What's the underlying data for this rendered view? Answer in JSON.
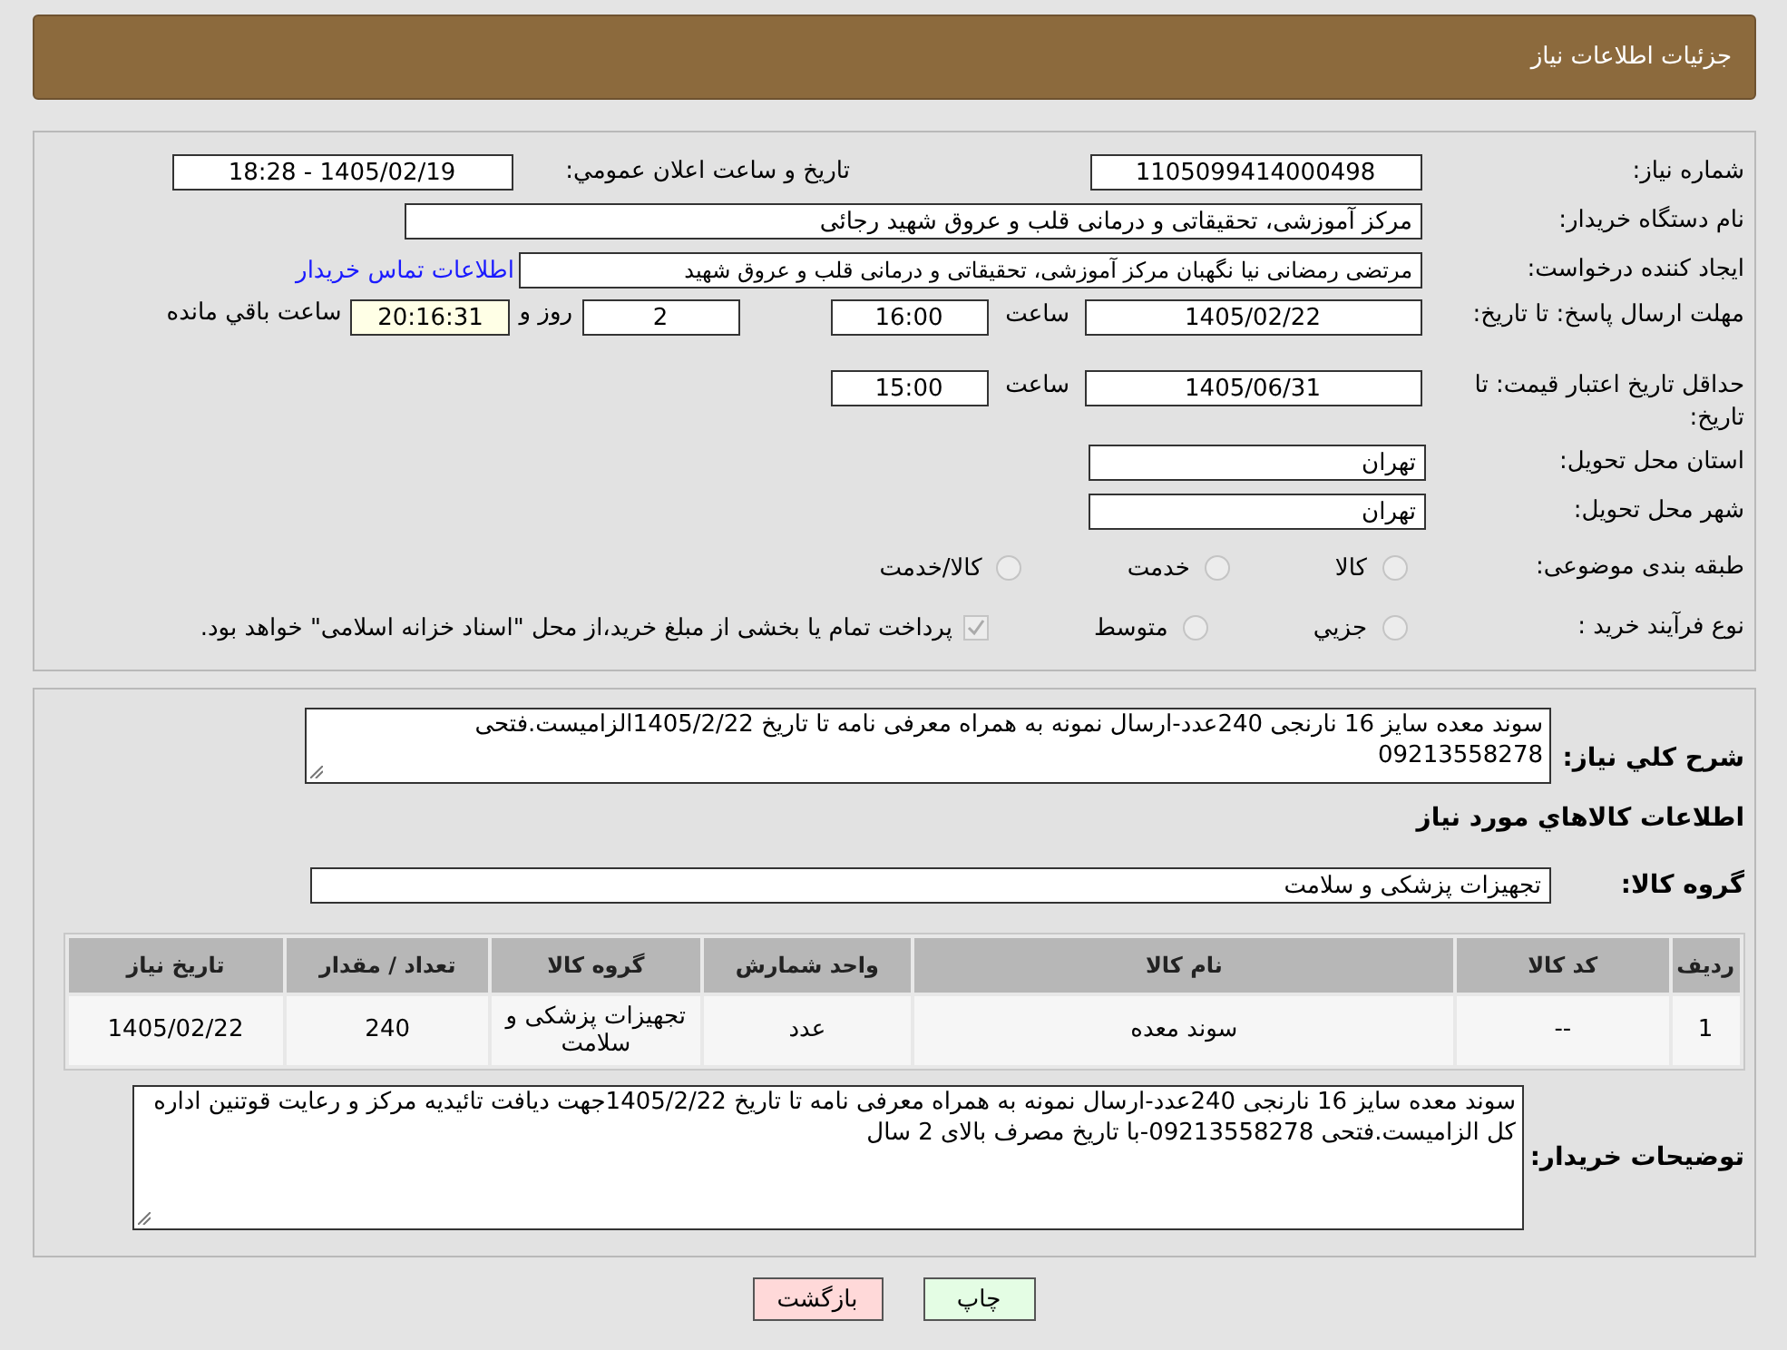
{
  "header": {
    "title": "جزئیات اطلاعات نیاز"
  },
  "need_number": {
    "label": "شماره نیاز:",
    "value": "1105099414000498"
  },
  "announce": {
    "label": "تاریخ و ساعت اعلان عمومي:",
    "value": "1405/02/19 - 18:28"
  },
  "buyer_org": {
    "label": "نام دستگاه خریدار:",
    "value": "مرکز آموزشی، تحقیقاتی و درمانی قلب و عروق شهید رجائی"
  },
  "requester": {
    "label": "ایجاد کننده درخواست:",
    "value": "مرتضی رمضانی نیا نگهبان مرکز آموزشی، تحقیقاتی و درمانی قلب و عروق شهید",
    "link": "اطلاعات تماس خریدار"
  },
  "reply_deadline": {
    "label": "مهلت ارسال پاسخ: تا تاریخ:",
    "date": "1405/02/22",
    "time_label": "ساعت",
    "time": "16:00",
    "days": "2",
    "days_label": "روز و",
    "remaining": "20:16:31",
    "remaining_label": "ساعت باقي مانده"
  },
  "price_validity": {
    "label": "حداقل تاریخ اعتبار قیمت: تا تاریخ:",
    "date": "1405/06/31",
    "time_label": "ساعت",
    "time": "15:00"
  },
  "province": {
    "label": "استان محل تحویل:",
    "value": "تهران"
  },
  "city": {
    "label": "شهر محل تحویل:",
    "value": "تهران"
  },
  "category": {
    "label": "طبقه بندی موضوعی:",
    "options": [
      {
        "label": "کالا",
        "selected": false
      },
      {
        "label": "خدمت",
        "selected": false
      },
      {
        "label": "کالا/خدمت",
        "selected": false
      }
    ]
  },
  "purchase_type": {
    "label": "نوع فرآیند خرید :",
    "options": [
      {
        "label": "جزيي",
        "selected": false
      },
      {
        "label": "متوسط",
        "selected": false
      }
    ],
    "payment_note": {
      "text": "پرداخت تمام یا بخشی از مبلغ خرید،از محل \"اسناد خزانه اسلامی\" خواهد بود.",
      "checked": true
    }
  },
  "description": {
    "label": "شرح کلي نیاز:",
    "value": "سوند معده سایز 16 نارنجی 240عدد-ارسال نمونه به همراه معرفی نامه تا تاریخ 1405/2/22الزامیست.فتحی 09213558278"
  },
  "items_heading": "اطلاعات کالاهاي مورد نیاز",
  "goods_group": {
    "label": "گروه کالا:",
    "value": "تجهیزات پزشکی و سلامت"
  },
  "table": {
    "columns": [
      "ردیف",
      "کد کالا",
      "نام کالا",
      "واحد شمارش",
      "گروه کالا",
      "تعداد / مقدار",
      "تاریخ نیاز"
    ],
    "rows": [
      [
        "1",
        "--",
        "سوند معده",
        "عدد",
        "تجهیزات پزشکی و سلامت",
        "240",
        "1405/02/22"
      ]
    ]
  },
  "buyer_notes": {
    "label": "توضیحات خریدار:",
    "value": "سوند معده سایز 16 نارنجی 240عدد-ارسال نمونه به همراه معرفی نامه تا تاریخ 1405/2/22جهت دیافت تائیدیه مرکز و رعایت قوتنین اداره کل الزامیست.فتحی 09213558278-با تاریخ مصرف بالای 2 سال"
  },
  "buttons": [
    {
      "label": "چاپ",
      "kind": "print"
    },
    {
      "label": "بازگشت",
      "kind": "back"
    }
  ]
}
